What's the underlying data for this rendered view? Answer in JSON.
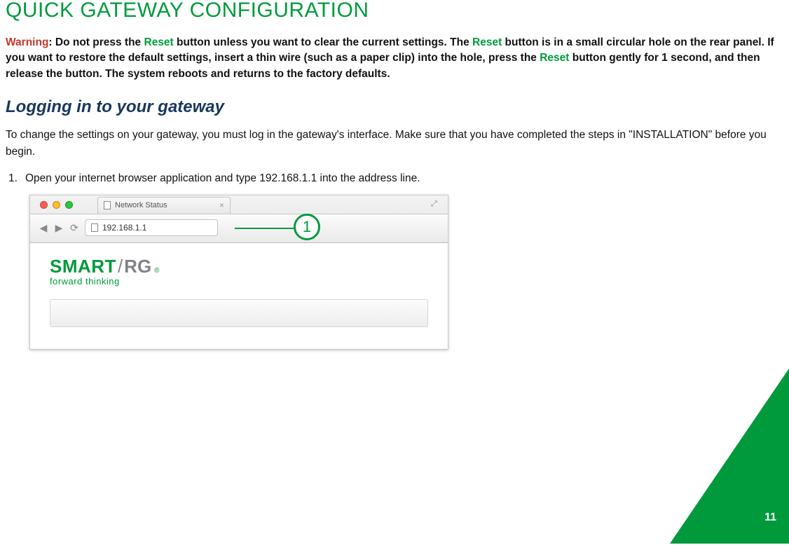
{
  "title": "QUICK GATEWAY CONFIGURATION",
  "warning": {
    "label": "Warning",
    "part1": ": Do not press the ",
    "reset1": "Reset",
    "part2": " button unless you want to clear the current settings. The ",
    "reset2": "Reset",
    "part3": " button is in a small circular hole on the rear panel. If you want to restore the default settings, insert a thin wire (such as a paper clip) into the hole, press the ",
    "reset3": "Reset",
    "part4": " button gently for 1 second, and then release the button. The system reboots and returns to the factory defaults."
  },
  "subheading": "Logging in to your gateway",
  "intro": "To change the settings on your gateway, you must log in the gateway's interface. Make sure that you have completed the steps in \"INSTALLATION\" before you begin.",
  "steps": [
    {
      "num": "1.",
      "text": "Open your internet browser application and type 192.168.1.1 into the address line."
    }
  ],
  "browser": {
    "tab_title": "Network Status",
    "address": "192.168.1.1",
    "callout_num": "1",
    "logo_smart": "SMART",
    "logo_slash": "/",
    "logo_rg": "RG",
    "logo_reg": "®",
    "tagline": "forward thinking"
  },
  "page_number": "11"
}
